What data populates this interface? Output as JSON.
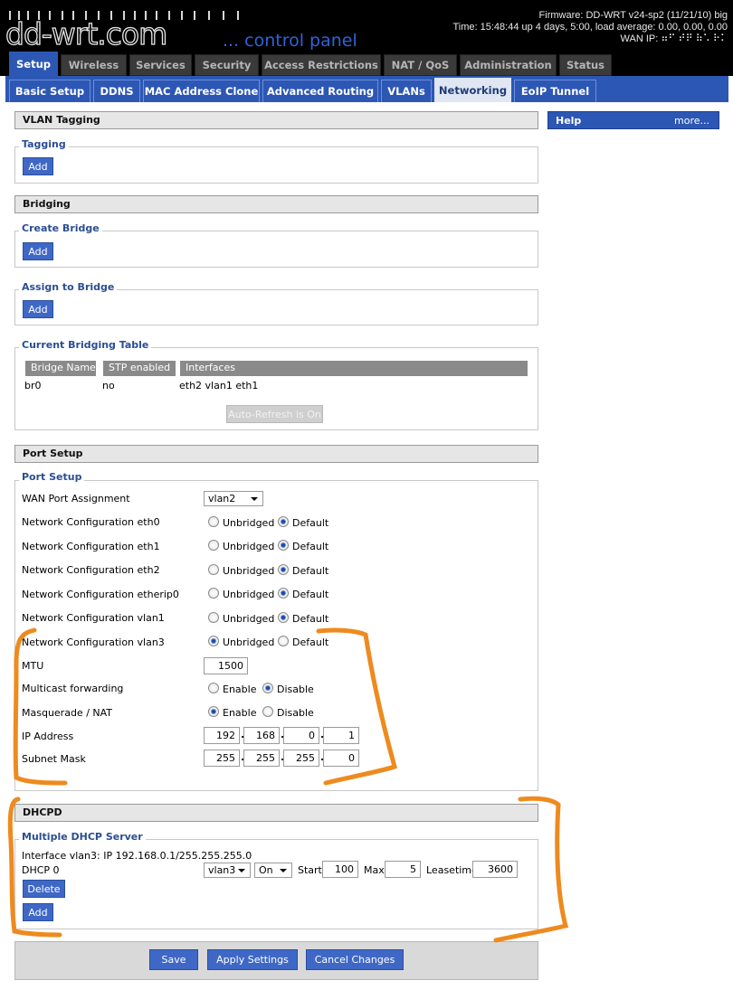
{
  "header": {
    "logo_text": "dd-wrt.com",
    "tagline": "... control panel",
    "firmware": "Firmware: DD-WRT v24-sp2 (11/21/10) big",
    "time": "Time: 15:48:44 up 4 days, 5:00, load average: 0.00, 0.00, 0.00",
    "wan_ip": "WAN IP: ⠶⠋ ⠞⠟ ⠷⠡ ⠗⠅"
  },
  "main_tabs": [
    {
      "label": "Setup",
      "active": true
    },
    {
      "label": "Wireless"
    },
    {
      "label": "Services"
    },
    {
      "label": "Security"
    },
    {
      "label": "Access Restrictions"
    },
    {
      "label": "NAT / QoS"
    },
    {
      "label": "Administration"
    },
    {
      "label": "Status"
    }
  ],
  "sub_tabs": [
    {
      "label": "Basic Setup"
    },
    {
      "label": "DDNS"
    },
    {
      "label": "MAC Address Clone"
    },
    {
      "label": "Advanced Routing"
    },
    {
      "label": "VLANs"
    },
    {
      "label": "Networking",
      "active": true
    },
    {
      "label": "EoIP Tunnel"
    }
  ],
  "help": {
    "title": "Help",
    "more": "more..."
  },
  "vlan_tagging": {
    "title": "VLAN Tagging",
    "tagging_legend": "Tagging",
    "add_label": "Add"
  },
  "bridging": {
    "title": "Bridging",
    "create_legend": "Create Bridge",
    "assign_legend": "Assign to Bridge",
    "table_legend": "Current Bridging Table",
    "add_label": "Add",
    "columns": [
      "Bridge Name",
      "STP enabled",
      "Interfaces"
    ],
    "rows": [
      [
        "br0",
        "no",
        "eth2 vlan1 eth1"
      ]
    ],
    "auto_refresh": "Auto-Refresh is On"
  },
  "port_setup": {
    "title": "Port Setup",
    "legend": "Port Setup",
    "wan_label": "WAN Port Assignment",
    "wan_value": "vlan2",
    "unbridged": "Unbridged",
    "default": "Default",
    "enable": "Enable",
    "disable": "Disable",
    "net_configs": [
      {
        "label": "Network Configuration eth0",
        "value": "Default"
      },
      {
        "label": "Network Configuration eth1",
        "value": "Default"
      },
      {
        "label": "Network Configuration eth2",
        "value": "Default"
      },
      {
        "label": "Network Configuration etherip0",
        "value": "Default"
      },
      {
        "label": "Network Configuration vlan1",
        "value": "Default"
      },
      {
        "label": "Network Configuration vlan3",
        "value": "Unbridged"
      }
    ],
    "mtu_label": "MTU",
    "mtu_value": "1500",
    "multicast_label": "Multicast forwarding",
    "multicast_value": "Disable",
    "masq_label": "Masquerade / NAT",
    "masq_value": "Enable",
    "ip_label": "IP Address",
    "ip": [
      "192",
      "168",
      "0",
      "1"
    ],
    "mask_label": "Subnet Mask",
    "mask": [
      "255",
      "255",
      "255",
      "0"
    ]
  },
  "dhcpd": {
    "title": "DHCPD",
    "legend": "Multiple DHCP Server",
    "interface_info": "Interface vlan3: IP 192.168.0.1/255.255.255.0",
    "row_label": "DHCP 0",
    "iface": "vlan3",
    "state": "On",
    "start_label": "Start",
    "start": "100",
    "max_label": "Max",
    "max": "5",
    "lease_label": "Leasetime",
    "lease": "3600",
    "delete_label": "Delete",
    "add_label": "Add"
  },
  "footer": {
    "save": "Save",
    "apply": "Apply Settings",
    "cancel": "Cancel Changes"
  },
  "colors": {
    "accent": "#2c57b4",
    "button": "#3f68c6",
    "annotation": "#ee8a1e"
  }
}
